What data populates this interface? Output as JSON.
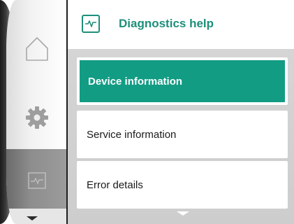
{
  "header": {
    "title": "Diagnostics help",
    "icon": "pulse-monitor-icon",
    "accent": "#1e8f7a"
  },
  "nav": {
    "items": [
      {
        "id": "home",
        "icon": "home-icon",
        "active": false
      },
      {
        "id": "settings",
        "icon": "gear-icon",
        "active": false
      },
      {
        "id": "diagnostics",
        "icon": "pulse-monitor-icon",
        "active": true
      }
    ],
    "scroll_indicator": "chevron-down-icon"
  },
  "menu": {
    "items": [
      {
        "label": "Device information",
        "selected": true
      },
      {
        "label": "Service information",
        "selected": false
      },
      {
        "label": "Error details",
        "selected": false
      }
    ],
    "selected_color": "#129c84",
    "scroll_indicator": "chevron-down-icon"
  }
}
